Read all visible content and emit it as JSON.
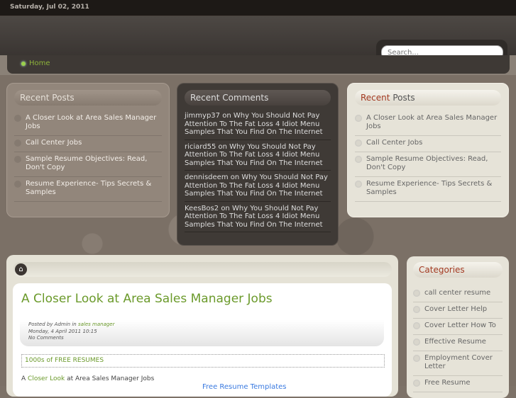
{
  "date": "Saturday, Jul 02, 2011",
  "search": {
    "placeholder": "Search..."
  },
  "nav": {
    "home": "Home"
  },
  "recent_posts_left": {
    "title": "Recent Posts",
    "items": [
      "A Closer Look at Area Sales Manager Jobs",
      "Call Center Jobs",
      "Sample Resume Objectives: Read, Don't Copy",
      "Resume Experience- Tips Secrets & Samples"
    ]
  },
  "recent_comments": {
    "title": "Recent Comments",
    "items": [
      {
        "author": "jimmyp37",
        "on": "on",
        "post": "Why You Should Not Pay Attention To The Fat Loss 4 Idiot Menu Samples That You Find On The Internet"
      },
      {
        "author": "riciard55",
        "on": "on",
        "post": "Why You Should Not Pay Attention To The Fat Loss 4 Idiot Menu Samples That You Find On The Internet"
      },
      {
        "author": "dennisdeem",
        "on": "on",
        "post": "Why You Should Not Pay Attention To The Fat Loss 4 Idiot Menu Samples That You Find On The Internet"
      },
      {
        "author": "KeesBos2",
        "on": "on",
        "post": "Why You Should Not Pay Attention To The Fat Loss 4 Idiot Menu Samples That You Find On The Internet"
      }
    ]
  },
  "recent_posts_right": {
    "title_a": "Recent",
    "title_b": "Posts",
    "items": [
      "A Closer Look at Area Sales Manager Jobs",
      "Call Center Jobs",
      "Sample Resume Objectives: Read, Don't Copy",
      "Resume Experience- Tips Secrets & Samples"
    ]
  },
  "post": {
    "title": "A Closer Look at Area Sales Manager Jobs",
    "posted_by": "Posted by Admin in",
    "category": "sales manager",
    "date": "Monday, 4 April 2011 10:15",
    "comments": "No Comments",
    "ad": "1000s of FREE RESUMES",
    "body_a": "A",
    "body_link": "Closer Look",
    "body_b": "at Area Sales Manager Jobs",
    "side_link": "Free Resume Templates"
  },
  "categories": {
    "title": "Categories",
    "items": [
      "call center resume",
      "Cover Letter Help",
      "Cover Letter How To",
      "Effective Resume",
      "Employment Cover Letter",
      "Free Resume"
    ]
  }
}
